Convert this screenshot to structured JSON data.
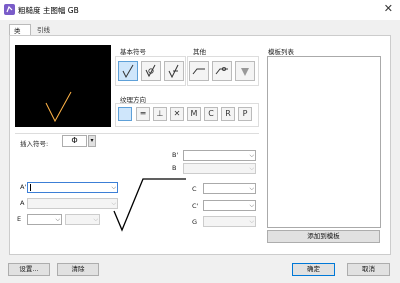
{
  "window": {
    "title": "粗糙度 主图幅 GB",
    "close_glyph": "✕"
  },
  "tabs": [
    {
      "label": "类型"
    },
    {
      "label": "引线"
    }
  ],
  "basic_symbols": {
    "label": "基本符号",
    "icons": [
      "checkmark-symbol-icon",
      "checkmark-circle-symbol-icon",
      "checkmark-bar-symbol-icon"
    ]
  },
  "other": {
    "label": "其他",
    "icons": [
      "line-icon",
      "line-circle-icon",
      "filled-triangle-icon"
    ]
  },
  "texture": {
    "label": "纹理方向",
    "buttons": [
      {
        "label": "",
        "icon": "empty-icon"
      },
      {
        "label": "═",
        "icon": "parallel-icon"
      },
      {
        "label": "⊥",
        "icon": "perpendicular-icon"
      },
      {
        "label": "✕",
        "icon": "cross-icon"
      },
      {
        "label": "M"
      },
      {
        "label": "C"
      },
      {
        "label": "R"
      },
      {
        "label": "P"
      }
    ]
  },
  "insert_symbol": {
    "label": "插入符号:",
    "value": "Φ",
    "arrow": "▾"
  },
  "fields": {
    "b_prime": "B'",
    "b": "B",
    "a_prime": "A'",
    "a": "A",
    "e": "E",
    "c": "C",
    "c_prime": "C'",
    "g": "G",
    "arrow": "⌵"
  },
  "templates": {
    "label": "模板列表",
    "items": []
  },
  "buttons": {
    "add_template": "添加到模板",
    "settings": "设置...",
    "clear": "清除",
    "ok": "确定",
    "cancel": "取消"
  }
}
